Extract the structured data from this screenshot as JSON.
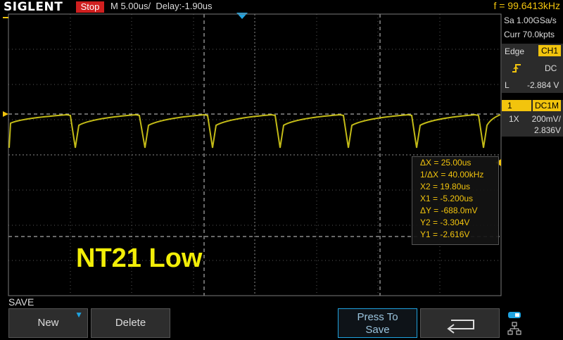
{
  "brand": "SIGLENT",
  "status": "Stop",
  "timebase": "M 5.00us/",
  "delay": "Delay:-1.90us",
  "frequency": "f = 99.6413kHz",
  "acquisition": {
    "sample_rate": "Sa 1.00GSa/s",
    "memory_depth": "Curr 70.0kpts"
  },
  "trigger": {
    "type": "Edge",
    "source": "CH1",
    "coupling": "DC",
    "level_label": "L",
    "level": "-2.884 V"
  },
  "channel1": {
    "number": "1",
    "coupling": "DC1M",
    "probe": "1X",
    "scale": "200mV/",
    "offset": "2.836V"
  },
  "cursors": [
    "ΔX = 25.00us",
    "1/ΔX = 40.00kHz",
    "X2 = 19.80us",
    "X1 = -5.200us",
    "ΔY = -688.0mV",
    "Y2 = -3.304V",
    "Y1 = -2.616V"
  ],
  "waveform_label": "NT21 Low",
  "menu": {
    "title": "SAVE",
    "new": "New",
    "delete": "Delete",
    "press_to_save_line1": "Press To",
    "press_to_save_line2": "Save"
  },
  "colors": {
    "trace": "#d8cf1a",
    "channel1": "#f2c40d",
    "stop": "#d01f1f",
    "accent": "#1fa3e0"
  },
  "icons": {
    "rising_edge": "rising-edge-icon",
    "return": "return-arrow-icon",
    "network": "network-icon"
  }
}
